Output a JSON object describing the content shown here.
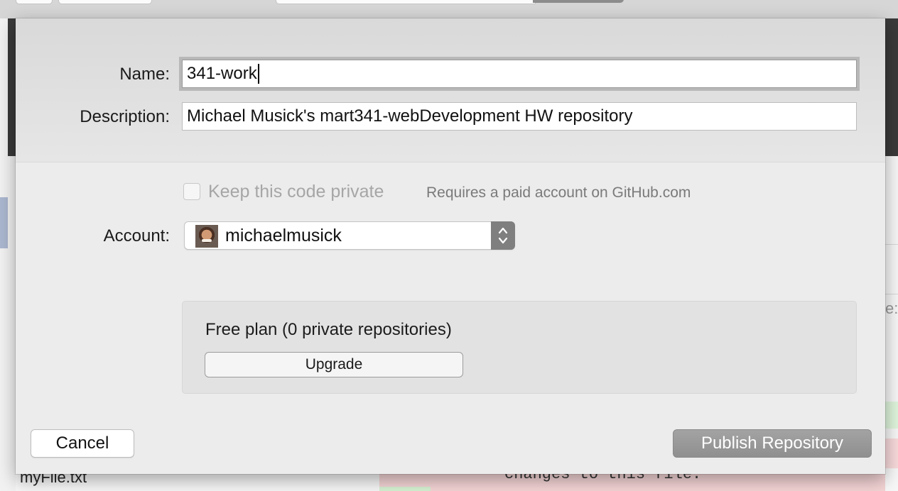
{
  "form": {
    "name_label": "Name:",
    "name_value": "341-work",
    "description_label": "Description:",
    "description_value": "Michael Musick's mart341-webDevelopment HW repository",
    "private_checkbox_label": "Keep this code private",
    "private_checkbox_checked": false,
    "private_note": "Requires a paid account on GitHub.com",
    "account_label": "Account:",
    "account_value": "michaelmusick"
  },
  "plan": {
    "title": "Free plan (0 private repositories)",
    "upgrade_label": "Upgrade"
  },
  "buttons": {
    "cancel": "Cancel",
    "publish": "Publish Repository"
  },
  "background": {
    "file_name": "myFile.txt",
    "code_line": "changes to this file.",
    "right_edge_fragment": "e:"
  }
}
